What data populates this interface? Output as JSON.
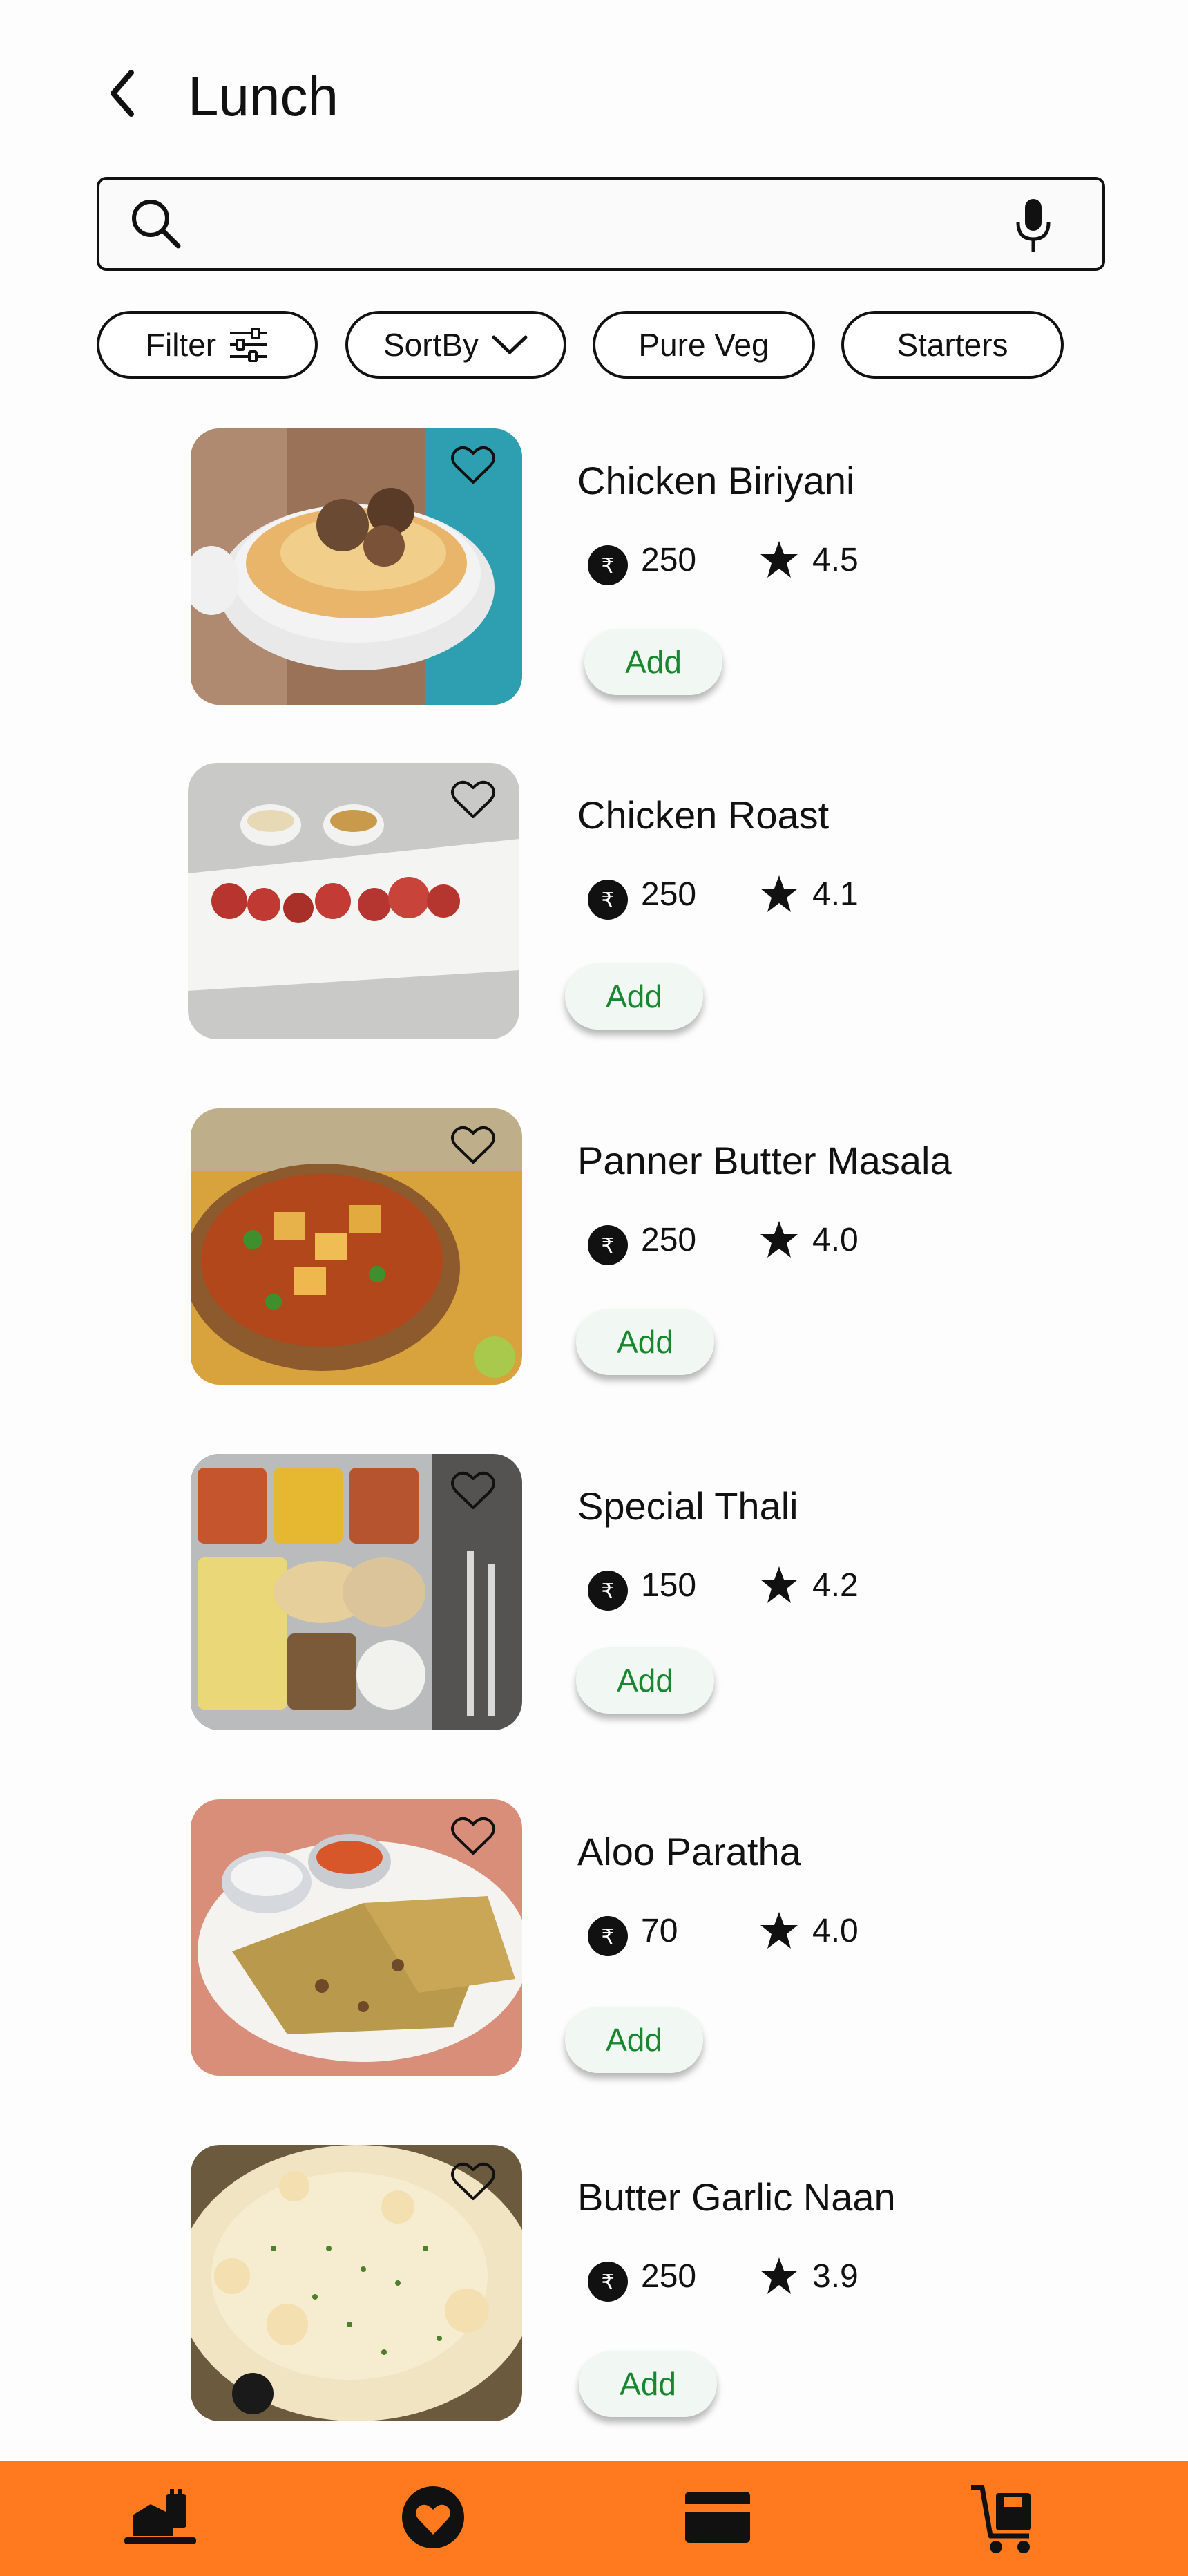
{
  "header": {
    "title": "Lunch"
  },
  "search": {
    "value": "",
    "placeholder": ""
  },
  "filters": [
    {
      "label": "Filter",
      "icon": "sliders-icon"
    },
    {
      "label": "SortBy",
      "icon": "chevron-down-icon"
    },
    {
      "label": "Pure Veg"
    },
    {
      "label": "Starters"
    }
  ],
  "items": [
    {
      "name": "Chicken Biriyani",
      "price": "250",
      "rating": "4.5",
      "add_label": "Add"
    },
    {
      "name": "Chicken Roast",
      "price": "250",
      "rating": "4.1",
      "add_label": "Add"
    },
    {
      "name": "Panner Butter Masala",
      "price": "250",
      "rating": "4.0",
      "add_label": "Add"
    },
    {
      "name": "Special Thali",
      "price": "150",
      "rating": "4.2",
      "add_label": "Add"
    },
    {
      "name": "Aloo Paratha",
      "price": "70",
      "rating": "4.0",
      "add_label": "Add"
    },
    {
      "name": "Butter Garlic Naan",
      "price": "250",
      "rating": "3.9",
      "add_label": "Add"
    }
  ],
  "currency_symbol": "₹",
  "colors": {
    "accent": "#ff7a1e",
    "add_text": "#19872f",
    "add_bg": "#f1f8f3"
  },
  "bottom_nav": [
    {
      "icon": "food-delivery-icon"
    },
    {
      "icon": "heart-icon"
    },
    {
      "icon": "card-icon"
    },
    {
      "icon": "cart-icon"
    }
  ]
}
